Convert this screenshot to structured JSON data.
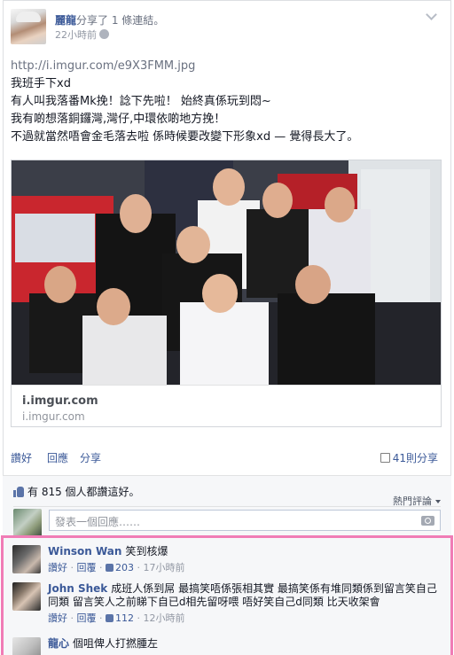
{
  "post": {
    "author": "麗龍",
    "action": "分享了 1 條連結。",
    "time": "22小時前",
    "link_url": "http://i.imgur.com/e9X3FMM.jpg",
    "text_lines": [
      "我班手下xd",
      "有人叫我落番Mk挽！諗下先啦！ 始終真係玩到悶~",
      "我有啲想落銅鑼灣,灣仔,中環依啲地方挽！",
      "不過就當然唔會金毛落去啦 係時候要改變下形象xd — 覺得長大了。"
    ],
    "attachment": {
      "domain": "i.imgur.com",
      "sub": "i.imgur.com"
    }
  },
  "actions": {
    "like": "讚好",
    "comment": "回應",
    "share": "分享",
    "share_count": "41則分享"
  },
  "ufi": {
    "likes_text": "有 815 個人都讚這好。",
    "sort_label": "熱門評論",
    "reply_placeholder": "發表一個回應……"
  },
  "comments": [
    {
      "author": "Winson Wan",
      "text": "笑到核爆",
      "like": "讚好",
      "reply": "回覆",
      "likes": "203",
      "time": "17小時前"
    },
    {
      "author": "John Shek",
      "text": "成班人係到屌 最搞笑唔係張相其實 最搞笑係有堆同類係到留言笑自己同類 留言笑人之前睇下自已d相先留呀喂 唔好笑自己d同類 比天收架會",
      "like": "讚好",
      "reply": "回覆",
      "likes": "112",
      "time": "12小時前"
    },
    {
      "author": "龍心",
      "text": "個咀俾人打撚腫左",
      "like": "",
      "reply": "",
      "likes": "",
      "time": ""
    }
  ],
  "colors": {
    "link_blue": "#3b5998",
    "highlight_border": "#f07cb6",
    "ufi_background": "#f6f7f9"
  }
}
